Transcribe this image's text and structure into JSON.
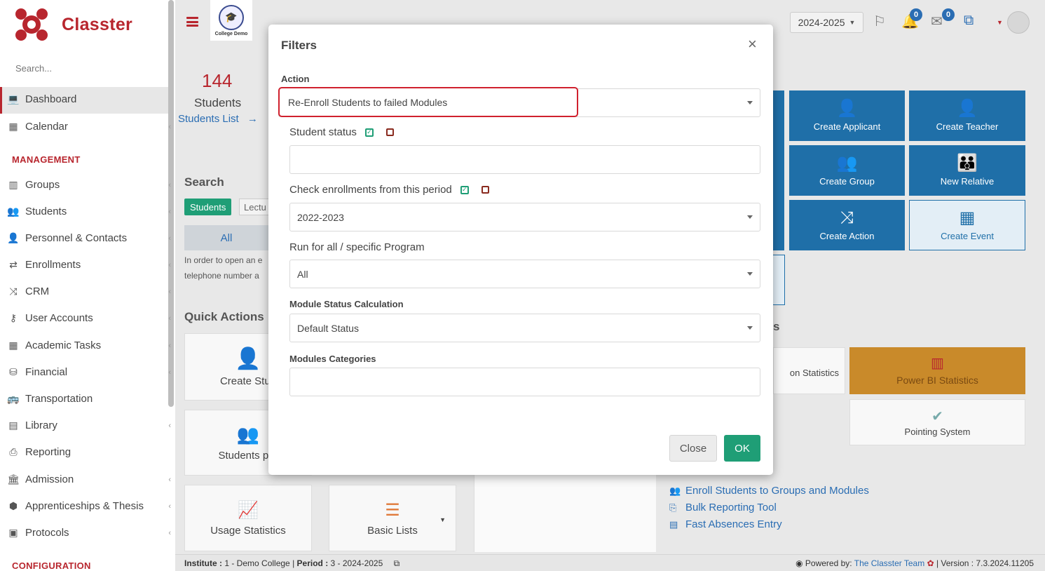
{
  "app": {
    "logo_text": "Classter",
    "college_name": "College Demo"
  },
  "sidebar": {
    "search_placeholder": "Search...",
    "items": [
      {
        "label": "Dashboard",
        "icon": "laptop-icon"
      },
      {
        "label": "Calendar",
        "icon": "calendar-icon"
      },
      {
        "label": "Groups",
        "icon": "groups-icon"
      },
      {
        "label": "Students",
        "icon": "students-icon"
      },
      {
        "label": "Personnel & Contacts",
        "icon": "person-icon"
      },
      {
        "label": "Enrollments",
        "icon": "exchange-icon"
      },
      {
        "label": "CRM",
        "icon": "shuffle-icon"
      },
      {
        "label": "User Accounts",
        "icon": "key-icon"
      },
      {
        "label": "Academic Tasks",
        "icon": "grid-icon"
      },
      {
        "label": "Financial",
        "icon": "coins-icon"
      },
      {
        "label": "Transportation",
        "icon": "bus-icon"
      },
      {
        "label": "Library",
        "icon": "books-icon"
      },
      {
        "label": "Reporting",
        "icon": "printer-icon"
      },
      {
        "label": "Admission",
        "icon": "building-icon"
      },
      {
        "label": "Apprenticeships & Thesis",
        "icon": "box-icon"
      },
      {
        "label": "Protocols",
        "icon": "archive-icon"
      }
    ],
    "sections": {
      "management": "MANAGEMENT",
      "configuration": "CONFIGURATION"
    }
  },
  "header": {
    "year": "2024-2025",
    "notifications_count": "0",
    "messages_count": "0"
  },
  "main": {
    "students_count": "144",
    "students_label": "Students",
    "students_link": "Students List",
    "search_title": "Search",
    "search_tabs": [
      "Students",
      "Lectu"
    ],
    "all_label": "All",
    "hint_line1": "In order to open an e",
    "hint_line2": "telephone number a",
    "quick_actions_title": "Quick Actions",
    "cards": [
      "Create Stud",
      "Students per",
      "Usage Statistics",
      "Basic Lists"
    ],
    "tiles": [
      "Create Applicant",
      "Create Teacher",
      "Create Group",
      "New Relative",
      "Create Action",
      "Create Event"
    ],
    "stats_partial": "on Statistics",
    "power_bi": "Power BI Statistics",
    "pointing_system": "Pointing System",
    "links": [
      "Enroll Students to Groups and Modules",
      "Bulk Reporting Tool",
      "Fast Absences Entry"
    ]
  },
  "footer": {
    "institute_label": "Institute :",
    "institute_value": "1 - Demo College",
    "period_label": "Period :",
    "period_value": "3 - 2024-2025",
    "powered_by": "Powered by:",
    "team": "The Classter Team",
    "version_label": "| Version :",
    "version_value": "7.3.2024.11205"
  },
  "modal": {
    "title": "Filters",
    "action_label": "Action",
    "action_value": "Re-Enroll Students to failed Modules",
    "student_status_label": "Student status",
    "student_status_value": "",
    "check_enrollments_label": "Check enrollments from this period",
    "check_enrollments_value": "2022-2023",
    "program_label": "Run for all / specific Program",
    "program_value": "All",
    "module_status_label": "Module Status Calculation",
    "module_status_value": "Default Status",
    "modules_categories_label": "Modules Categories",
    "modules_categories_value": "",
    "close_button": "Close",
    "ok_button": "OK"
  },
  "colors": {
    "brand": "#b8262e",
    "primary": "#1f6fa8",
    "success": "#1f9e76",
    "highlight_border": "#d0212e"
  }
}
